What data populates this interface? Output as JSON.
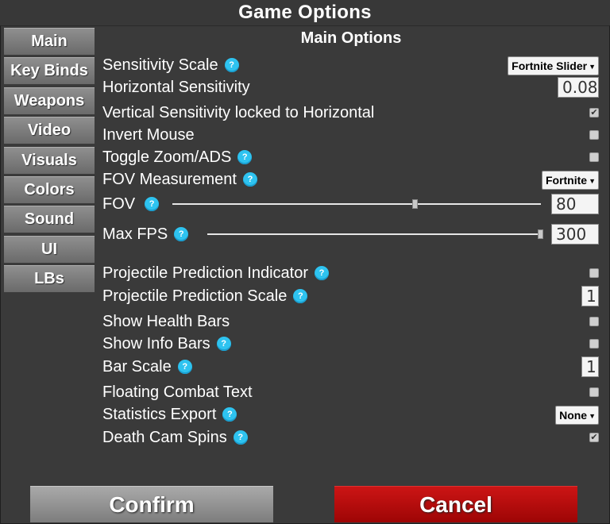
{
  "window": {
    "title": "Game Options"
  },
  "tabs": [
    "Main",
    "Key Binds",
    "Weapons",
    "Video",
    "Visuals",
    "Colors",
    "Sound",
    "UI",
    "LBs"
  ],
  "section_title": "Main Options",
  "options": {
    "sensitivity_scale": {
      "label": "Sensitivity Scale",
      "value": "Fortnite Slider"
    },
    "horizontal_sensitivity": {
      "label": "Horizontal Sensitivity",
      "value": "0.08"
    },
    "vertical_locked": {
      "label": "Vertical Sensitivity locked to Horizontal",
      "checked": true
    },
    "invert_mouse": {
      "label": "Invert Mouse",
      "checked": false
    },
    "toggle_zoom": {
      "label": "Toggle Zoom/ADS",
      "checked": false
    },
    "fov_measurement": {
      "label": "FOV Measurement",
      "value": "Fortnite"
    },
    "fov": {
      "label": "FOV",
      "value": "80",
      "slider_fraction": 0.66
    },
    "max_fps": {
      "label": "Max FPS",
      "value": "300",
      "slider_fraction": 1.0
    },
    "projectile_indicator": {
      "label": "Projectile Prediction Indicator",
      "checked": false
    },
    "projectile_scale": {
      "label": "Projectile Prediction Scale",
      "value": "1"
    },
    "show_health_bars": {
      "label": "Show Health Bars",
      "checked": false
    },
    "show_info_bars": {
      "label": "Show Info Bars",
      "checked": false
    },
    "bar_scale": {
      "label": "Bar Scale",
      "value": "1"
    },
    "floating_combat_text": {
      "label": "Floating Combat Text",
      "checked": false
    },
    "statistics_export": {
      "label": "Statistics Export",
      "value": "None"
    },
    "death_cam_spins": {
      "label": "Death Cam Spins",
      "checked": true
    }
  },
  "buttons": {
    "confirm": "Confirm",
    "cancel": "Cancel"
  },
  "icons": {
    "help": "?",
    "check": "✔",
    "dropdown_arrow": "▼"
  },
  "colors": {
    "help_icon": "#2ec3f0",
    "cancel": "#b80c0c",
    "confirm": "#8f8f8f",
    "background": "#3a3a3a"
  }
}
